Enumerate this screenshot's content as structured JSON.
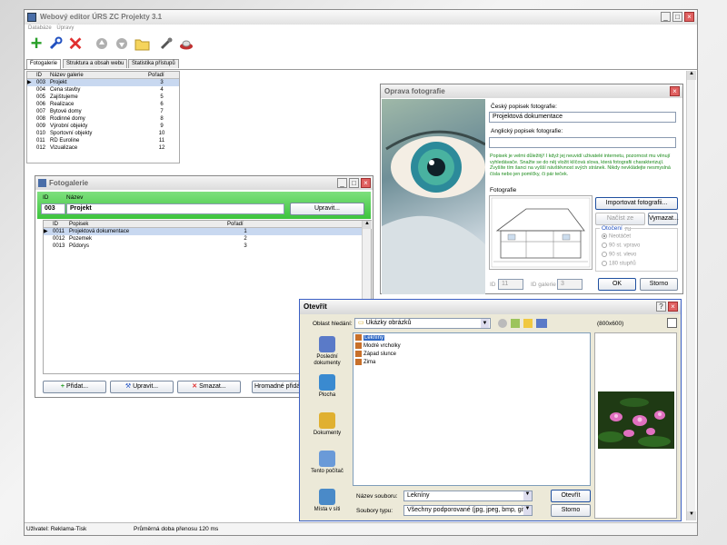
{
  "app": {
    "title": "Webový editor ÚRS ZC Projekty 3.1",
    "menu": [
      "Databáze",
      "Úpravy"
    ],
    "tabs": [
      "Fotogalerie",
      "Struktura a obsah webu",
      "Statistika přístupů"
    ],
    "status_user": "Uživatel: Reklama-Tisk",
    "status_transfer": "Průměrná doba přenosu 120 ms"
  },
  "gallery_list": {
    "headers": [
      "ID",
      "Název galerie",
      "Pořadí"
    ],
    "rows": [
      {
        "id": "003",
        "name": "Projekt",
        "order": "3"
      },
      {
        "id": "004",
        "name": "Cena stavby",
        "order": "4"
      },
      {
        "id": "005",
        "name": "Zajištujeme",
        "order": "5"
      },
      {
        "id": "006",
        "name": "Realizace",
        "order": "6"
      },
      {
        "id": "007",
        "name": "Bytové domy",
        "order": "7"
      },
      {
        "id": "008",
        "name": "Rodinné domy",
        "order": "8"
      },
      {
        "id": "009",
        "name": "Výrobní objekty",
        "order": "9"
      },
      {
        "id": "010",
        "name": "Sportovní objekty",
        "order": "10"
      },
      {
        "id": "011",
        "name": "RD Euroline",
        "order": "11"
      },
      {
        "id": "012",
        "name": "Vizualizace",
        "order": "12"
      }
    ]
  },
  "fotogalerie": {
    "title": "Fotogalerie",
    "label_id": "ID",
    "label_name": "Název",
    "id_value": "003",
    "name_value": "Projekt",
    "edit_button": "Upravit...",
    "headers": [
      "ID",
      "Popisek",
      "Pořadí"
    ],
    "rows": [
      {
        "id": "0011",
        "caption": "Projektová dokumentace",
        "order": "1"
      },
      {
        "id": "0012",
        "caption": "Pozemek",
        "order": "2"
      },
      {
        "id": "0013",
        "caption": "Půdorys",
        "order": "3"
      }
    ],
    "btn_add": "Přidat...",
    "btn_edit": "Upravit...",
    "btn_delete": "Smazat...",
    "btn_bulk": "Hromadné přidán"
  },
  "oprava": {
    "title": "Oprava fotografie",
    "czech_label": "Český popisek fotografie:",
    "czech_value": "Projektová dokumentace",
    "english_label": "Anglický popisek fotografie:",
    "english_value": "",
    "hint": "Popisek je velmi důležitý! I když jej neuvidí uživatelé internetu, pozornost mu věnují vyhledávače. Snažte se do něj vložit klíčová slova, která fotografii charakterizují. Zvyšíte tím šanci na vyšší návštěvnost svých stránek. Nikdy nevkládejte nesmyslná čísla nebo jen pomlčky, či pár teček.",
    "photo_label": "Fotografie",
    "btn_import": "Importovat fotografii...",
    "btn_load": "Načíst ze serveru",
    "btn_delete": "Vymazat...",
    "rotation_label": "Otočení",
    "rotation_options": [
      "Neotáčet",
      "90 st. vpravo",
      "90 st. vlevo",
      "180 stupňů"
    ],
    "id_label": "ID",
    "id_value": "11",
    "gallery_id_label": "ID galerie",
    "gallery_id_value": "3",
    "btn_ok": "OK",
    "btn_cancel": "Storno"
  },
  "open_dialog": {
    "title": "Otevřít",
    "look_in_label": "Oblast hledání:",
    "look_in_value": "Ukázky obrázků",
    "files": [
      "Lekníny",
      "Modré vrcholky",
      "Západ slunce",
      "Zima"
    ],
    "places": [
      "Poslední dokumenty",
      "Plocha",
      "Dokumenty",
      "Tento počítač",
      "Místa v síti"
    ],
    "preview_size": "(800x600)",
    "filename_label": "Název souboru:",
    "filename_value": "Lekníny",
    "filetype_label": "Soubory typu:",
    "filetype_value": "Všechny podporované (jpg, jpeg, bmp, gif)",
    "btn_open": "Otevřít",
    "btn_cancel": "Storno"
  },
  "colors": {
    "green_header": "#3cc43c",
    "selection": "#c8d8f0",
    "xp_blue": "#1f5fc4"
  }
}
